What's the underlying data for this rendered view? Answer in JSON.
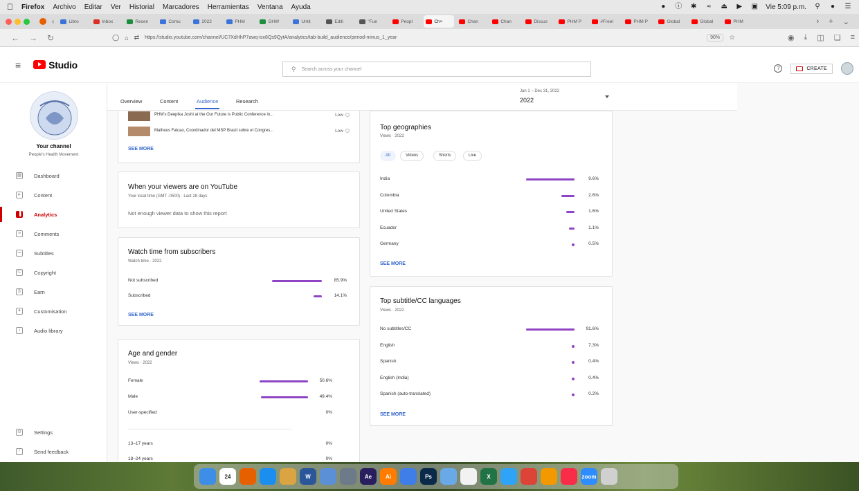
{
  "menubar": {
    "app": "Firefox",
    "items": [
      "Archivo",
      "Editar",
      "Ver",
      "Historial",
      "Marcadores",
      "Herramientas",
      "Ventana",
      "Ayuda"
    ],
    "clock": "Vie 5:09 p.m."
  },
  "tabs": [
    {
      "label": "Libro",
      "color": "#3b73d9"
    },
    {
      "label": "Inbox",
      "color": "#d93025"
    },
    {
      "label": "Recen",
      "color": "#1e8e3e"
    },
    {
      "label": "Comu",
      "color": "#3b73d9"
    },
    {
      "label": "2022",
      "color": "#3b73d9"
    },
    {
      "label": "PHM",
      "color": "#3b73d9"
    },
    {
      "label": "GHW",
      "color": "#1e8e3e"
    },
    {
      "label": "Untit",
      "color": "#3b73d9"
    },
    {
      "label": "Editi",
      "color": "#555555"
    },
    {
      "label": "\"Fue",
      "color": "#555555"
    },
    {
      "label": "Peopl",
      "color": "#ff0000"
    },
    {
      "label": "Ch",
      "color": "#ff0000",
      "active": true
    },
    {
      "label": "Chan",
      "color": "#ff0000"
    },
    {
      "label": "Chan",
      "color": "#ff0000"
    },
    {
      "label": "Discus",
      "color": "#ff0000"
    },
    {
      "label": "PHM P",
      "color": "#ff0000"
    },
    {
      "label": "#FreeI",
      "color": "#ff0000"
    },
    {
      "label": "PHM P",
      "color": "#ff0000"
    },
    {
      "label": "Global",
      "color": "#ff0000"
    },
    {
      "label": "Global",
      "color": "#ff0000"
    },
    {
      "label": "PHM",
      "color": "#ff0000"
    }
  ],
  "navbar": {
    "url": "https://studio.youtube.com/channel/UC7XdHhP7awq-isx8Qs9QytA/analytics/tab-build_audience/period-minus_1_year",
    "zoom": "90%"
  },
  "header": {
    "logo_text": "Studio",
    "search_placeholder": "Search across your channel",
    "create_label": "CREATE"
  },
  "sidebar": {
    "channel_title": "Your channel",
    "channel_name": "People's Health Movement",
    "items": [
      {
        "label": "Dashboard",
        "icon": "dashboard-icon"
      },
      {
        "label": "Content",
        "icon": "content-icon"
      },
      {
        "label": "Analytics",
        "icon": "analytics-icon",
        "active": true
      },
      {
        "label": "Comments",
        "icon": "comments-icon"
      },
      {
        "label": "Subtitles",
        "icon": "subtitles-icon"
      },
      {
        "label": "Copyright",
        "icon": "copyright-icon"
      },
      {
        "label": "Earn",
        "icon": "earn-icon"
      },
      {
        "label": "Customisation",
        "icon": "customisation-icon"
      },
      {
        "label": "Audio library",
        "icon": "audio-library-icon"
      }
    ],
    "bottom_items": [
      {
        "label": "Settings",
        "icon": "settings-icon"
      },
      {
        "label": "Send feedback",
        "icon": "feedback-icon"
      }
    ]
  },
  "analytics_tabs": [
    "Overview",
    "Content",
    "Audience",
    "Research"
  ],
  "date": {
    "range": "Jan 1 – Dec 31, 2022",
    "year": "2022"
  },
  "videos_card": {
    "rows": [
      {
        "title": "PHM's Deepika Joshi at the Our Future is Public Conference in...",
        "level": "Low"
      },
      {
        "title": "Matheus Falcao, Coordinador del MSP Brasil sobre el Congres...",
        "level": "Low"
      }
    ],
    "see_more": "SEE MORE"
  },
  "when_card": {
    "title": "When your viewers are on YouTube",
    "subtitle": "Your local time (GMT -0500) · Last 28 days",
    "message": "Not enough viewer data to show this report"
  },
  "watch_card": {
    "title": "Watch time from subscribers",
    "subtitle": "Watch time · 2022",
    "rows": [
      {
        "label": "Not subscribed",
        "value": "85.9%",
        "pct": 85.9
      },
      {
        "label": "Subscribed",
        "value": "14.1%",
        "pct": 14.1
      }
    ],
    "see_more": "SEE MORE"
  },
  "age_card": {
    "title": "Age and gender",
    "subtitle": "Views · 2022",
    "gender_rows": [
      {
        "label": "Female",
        "value": "50.6%",
        "pct": 50.6
      },
      {
        "label": "Male",
        "value": "49.4%",
        "pct": 49.4
      },
      {
        "label": "User-specified",
        "value": "0%",
        "pct": 0
      }
    ],
    "age_rows": [
      {
        "label": "13–17 years",
        "value": "0%",
        "pct": 0
      },
      {
        "label": "18–24 years",
        "value": "0%",
        "pct": 0
      }
    ]
  },
  "geo_card": {
    "title": "Top geographies",
    "subtitle": "Views · 2022",
    "chips": [
      "All",
      "Videos",
      "Shorts",
      "Live"
    ],
    "rows": [
      {
        "label": "India",
        "value": "9.6%",
        "pct": 9.6
      },
      {
        "label": "Colombia",
        "value": "2.6%",
        "pct": 2.6
      },
      {
        "label": "United States",
        "value": "1.6%",
        "pct": 1.6
      },
      {
        "label": "Ecuador",
        "value": "1.1%",
        "pct": 1.1
      },
      {
        "label": "Germany",
        "value": "0.5%",
        "pct": 0.5
      }
    ],
    "see_more": "SEE MORE"
  },
  "subs_card": {
    "title": "Top subtitle/CC languages",
    "subtitle": "Views · 2022",
    "rows": [
      {
        "label": "No subtitles/CC",
        "value": "91.6%",
        "pct": 91.6
      },
      {
        "label": "English",
        "value": "7.3%",
        "pct": 7.3
      },
      {
        "label": "Spanish",
        "value": "0.4%",
        "pct": 0.4
      },
      {
        "label": "English (India)",
        "value": "0.4%",
        "pct": 0.4
      },
      {
        "label": "Spanish (auto-translated)",
        "value": "0.2%",
        "pct": 0.2
      }
    ],
    "see_more": "SEE MORE"
  },
  "dock": [
    {
      "label": "Finder",
      "color": "#3d8ee6",
      "text": ""
    },
    {
      "label": "Calendar",
      "color": "#ffffff",
      "text": "24"
    },
    {
      "label": "Firefox",
      "color": "#e66000",
      "text": ""
    },
    {
      "label": "Safari",
      "color": "#1c8ef0",
      "text": ""
    },
    {
      "label": "Notes",
      "color": "#d9a441",
      "text": ""
    },
    {
      "label": "Word",
      "color": "#2b579a",
      "text": "W"
    },
    {
      "label": "Preview",
      "color": "#5b8fd6",
      "text": ""
    },
    {
      "label": "Launchpad",
      "color": "#6c7a89",
      "text": ""
    },
    {
      "label": "After Effects",
      "color": "#2a1f5e",
      "text": "Ae"
    },
    {
      "label": "Illustrator",
      "color": "#ff7c00",
      "text": "Ai"
    },
    {
      "label": "Files",
      "color": "#3f7ee8",
      "text": ""
    },
    {
      "label": "Photoshop",
      "color": "#0b2a4a",
      "text": "Ps"
    },
    {
      "label": "Finder2",
      "color": "#6aa9e8",
      "text": ""
    },
    {
      "label": "Pages",
      "color": "#f2f2f2",
      "text": ""
    },
    {
      "label": "Excel",
      "color": "#217346",
      "text": "X"
    },
    {
      "label": "Messages",
      "color": "#2fa3f5",
      "text": ""
    },
    {
      "label": "Chrome",
      "color": "#db4437",
      "text": ""
    },
    {
      "label": "Photos",
      "color": "#f29900",
      "text": ""
    },
    {
      "label": "Music",
      "color": "#fa2d48",
      "text": ""
    },
    {
      "label": "Zoom",
      "color": "#2d8cff",
      "text": "zoom"
    },
    {
      "label": "Trash",
      "color": "#d0d0d0",
      "text": ""
    }
  ]
}
